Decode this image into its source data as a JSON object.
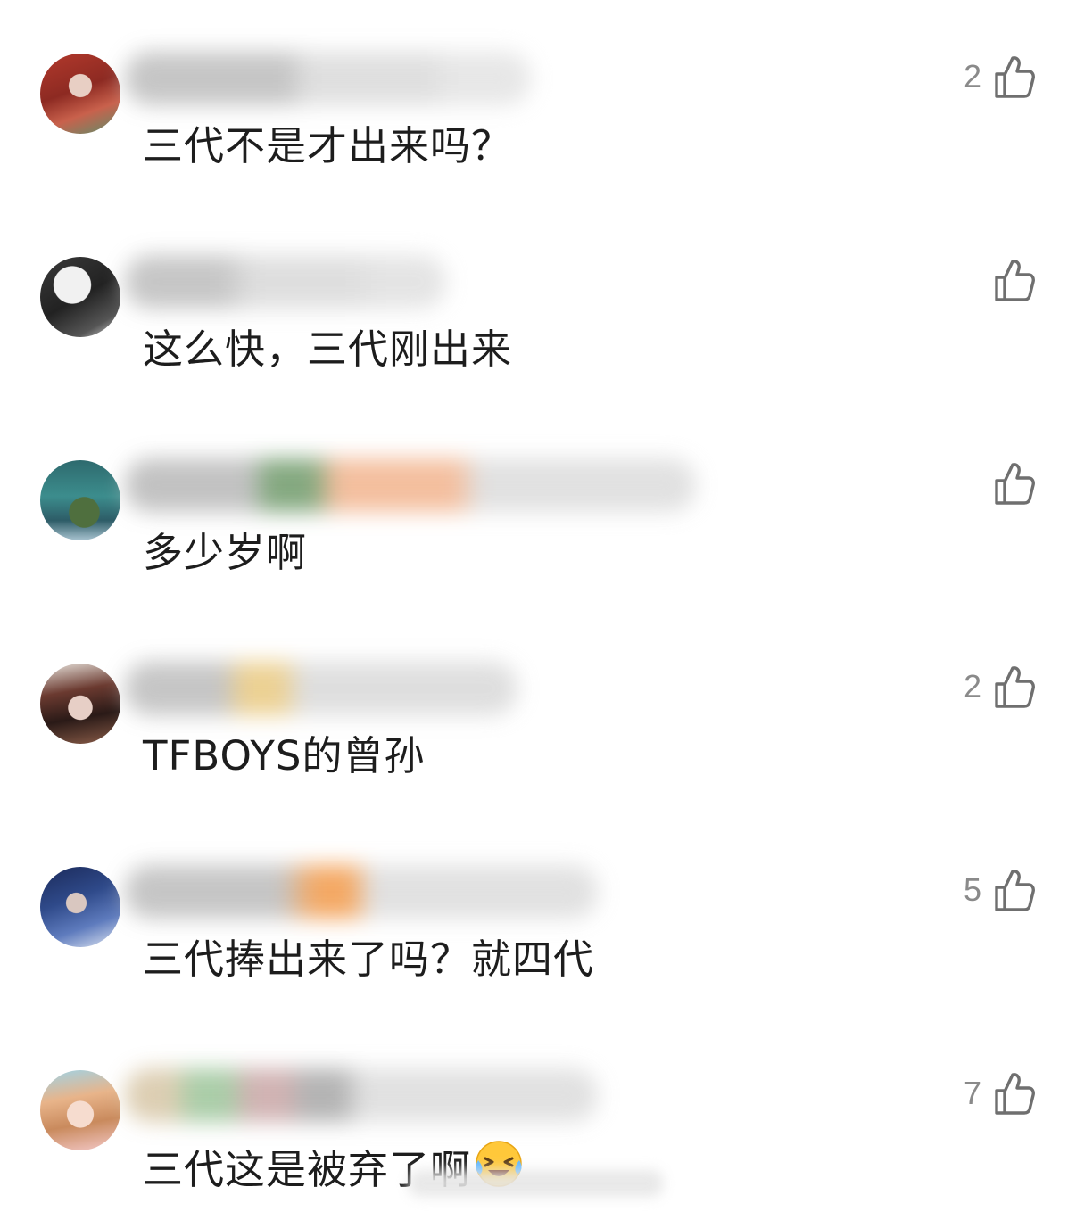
{
  "comments": [
    {
      "text": "三代不是才出来吗？",
      "likes": "2"
    },
    {
      "text": "这么快，三代刚出来",
      "likes": ""
    },
    {
      "text": "多少岁啊",
      "likes": ""
    },
    {
      "text": "TFBOYS的曾孙",
      "likes": "2"
    },
    {
      "text": "三代捧出来了吗？就四代",
      "likes": "5"
    },
    {
      "text": "三代这是被弃了啊",
      "likes": "7"
    }
  ],
  "icons": {
    "like": "thumbs-up-outline-icon",
    "emoji": "laughing-tears-emoji-icon"
  },
  "colors": {
    "text": "#1d1d1d",
    "like_count": "#8a8a8a",
    "icon_stroke": "#6f6f6f",
    "background": "#ffffff"
  }
}
